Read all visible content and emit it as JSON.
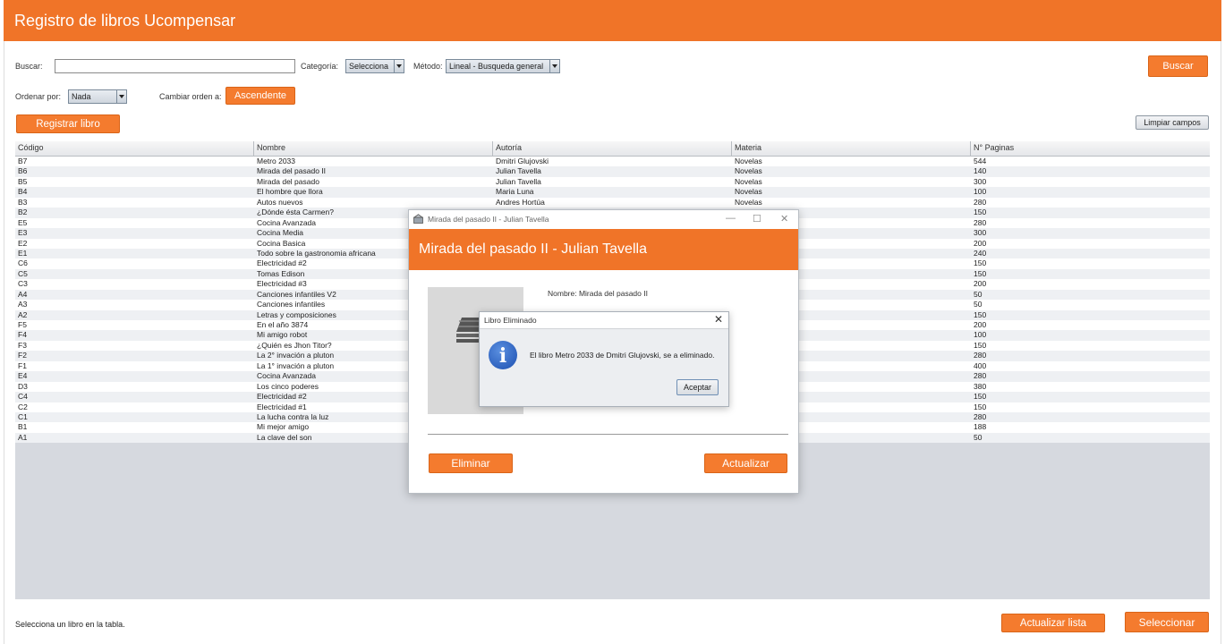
{
  "app": {
    "title": "Registro de libros Ucompensar",
    "accent": "#f07428"
  },
  "toolbar": {
    "search_label": "Buscar:",
    "search_value": "",
    "category_label": "Categoría:",
    "category_value": "Selecciona",
    "method_label": "Método:",
    "method_value": "Lineal - Busqueda general",
    "search_button": "Buscar",
    "sort_label": "Ordenar por:",
    "sort_value": "Nada",
    "order_label": "Cambiar orden a:",
    "order_button": "Ascendente",
    "register_button": "Registrar libro",
    "clear_button": "Limpiar campos"
  },
  "table": {
    "columns": [
      "Código",
      "Nombre",
      "Autoría",
      "Materia",
      "N° Paginas"
    ],
    "rows": [
      [
        "B7",
        "Metro 2033",
        "Dmitri Glujovski",
        "Novelas",
        "544"
      ],
      [
        "B6",
        "Mirada del pasado II",
        "Julian Tavella",
        "Novelas",
        "140"
      ],
      [
        "B5",
        "Mirada del pasado",
        "Julian Tavella",
        "Novelas",
        "300"
      ],
      [
        "B4",
        "El hombre que llora",
        "Maria Luna",
        "Novelas",
        "100"
      ],
      [
        "B3",
        "Autos nuevos",
        "Andres Hortúa",
        "Novelas",
        "280"
      ],
      [
        "B2",
        "¿Dónde ésta Carmen?",
        "",
        "",
        "150"
      ],
      [
        "E5",
        "Cocina Avanzada",
        "",
        "",
        "280"
      ],
      [
        "E3",
        "Cocina Media",
        "",
        "",
        "300"
      ],
      [
        "E2",
        "Cocina Basica",
        "",
        "",
        "200"
      ],
      [
        "E1",
        "Todo sobre la gastronomia africana",
        "",
        "",
        "240"
      ],
      [
        "C6",
        "Electricidad #2",
        "",
        "",
        "150"
      ],
      [
        "C5",
        "Tomas Edison",
        "",
        "",
        "150"
      ],
      [
        "C3",
        "Electricidad #3",
        "",
        "",
        "200"
      ],
      [
        "A4",
        "Canciones infantiles V2",
        "",
        "",
        "50"
      ],
      [
        "A3",
        "Canciones infantiles",
        "",
        "",
        "50"
      ],
      [
        "A2",
        "Letras y composiciones",
        "",
        "",
        "150"
      ],
      [
        "F5",
        "En el año 3874",
        "",
        "",
        "200"
      ],
      [
        "F4",
        "Mi amigo robot",
        "",
        "",
        "100"
      ],
      [
        "F3",
        "¿Quién es Jhon Titor?",
        "",
        "",
        "150"
      ],
      [
        "F2",
        "La 2° invación a pluton",
        "",
        "",
        "280"
      ],
      [
        "F1",
        "La 1° invación a pluton",
        "",
        "",
        "400"
      ],
      [
        "E4",
        "Cocina Avanzada",
        "",
        "",
        "280"
      ],
      [
        "D3",
        "Los cinco poderes",
        "",
        "",
        "380"
      ],
      [
        "C4",
        "Electricidad #2",
        "",
        "",
        "150"
      ],
      [
        "C2",
        "Electricidad #1",
        "",
        "",
        "150"
      ],
      [
        "C1",
        "La lucha contra la luz",
        "",
        "",
        "280"
      ],
      [
        "B1",
        "Mi mejor amigo",
        "",
        "",
        "188"
      ],
      [
        "A1",
        "La clave del son",
        "",
        "",
        "50"
      ]
    ]
  },
  "footer": {
    "status": "Selecciona un libro en la tabla.",
    "refresh_button": "Actualizar lista",
    "select_button": "Seleccionar"
  },
  "dialog": {
    "window_title": "Mirada del pasado II - Julian Tavella",
    "header_title": "Mirada del pasado II - Julian Tavella",
    "name_line": "Nombre: Mirada del pasado II",
    "delete_button": "Eliminar",
    "update_button": "Actualizar"
  },
  "message": {
    "title": "Libro Eliminado",
    "text": "El libro Metro 2033 de Dmitri Glujovski, se a eliminado.",
    "ok_button": "Aceptar",
    "icon": "info-icon"
  }
}
